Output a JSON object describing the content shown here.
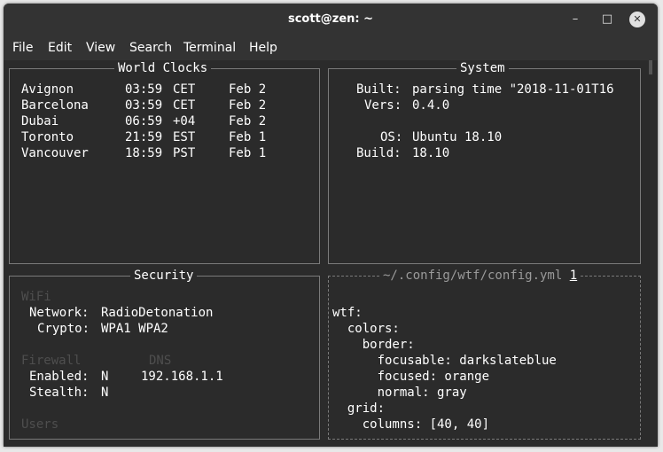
{
  "window": {
    "title": "scott@zen: ~"
  },
  "menu": [
    "File",
    "Edit",
    "View",
    "Search",
    "Terminal",
    "Help"
  ],
  "icons": {
    "minimize": "minimize-icon",
    "maximize": "maximize-icon",
    "close": "close-icon"
  },
  "panels": {
    "world_clocks": {
      "title": "World Clocks",
      "rows": [
        {
          "city": "Avignon",
          "time": "03:59",
          "zone": "CET",
          "date": "Feb 2"
        },
        {
          "city": "Barcelona",
          "time": "03:59",
          "zone": "CET",
          "date": "Feb 2"
        },
        {
          "city": "Dubai",
          "time": "06:59",
          "zone": "+04",
          "date": "Feb 2"
        },
        {
          "city": "Toronto",
          "time": "21:59",
          "zone": "EST",
          "date": "Feb 1"
        },
        {
          "city": "Vancouver",
          "time": "18:59",
          "zone": "PST",
          "date": "Feb 1"
        }
      ]
    },
    "system": {
      "title": "System",
      "built_label": "Built:",
      "built_value": "parsing time \"2018-11-01T16",
      "vers_label": "Vers:",
      "vers_value": "0.4.0",
      "os_label": "OS:",
      "os_value": "Ubuntu 18.10",
      "build_label": "Build:",
      "build_value": "18.10"
    },
    "security": {
      "title": "Security",
      "wifi_heading": "WiFi",
      "network_label": "Network:",
      "network_value": "RadioDetonation",
      "crypto_label": "Crypto:",
      "crypto_value": "WPA1 WPA2",
      "firewall_heading": "Firewall",
      "dns_heading": "DNS",
      "enabled_label": "Enabled:",
      "enabled_value": "N",
      "stealth_label": "Stealth:",
      "stealth_value": "N",
      "dns_value": "192.168.1.1",
      "users_heading": "Users"
    },
    "config": {
      "title": "~/.config/wtf/config.yml",
      "title_index": "1",
      "lines": [
        "wtf:",
        "  colors:",
        "    border:",
        "      focusable: darkslateblue",
        "      focused: orange",
        "      normal: gray",
        "  grid:",
        "    columns: [40, 40]"
      ]
    }
  }
}
